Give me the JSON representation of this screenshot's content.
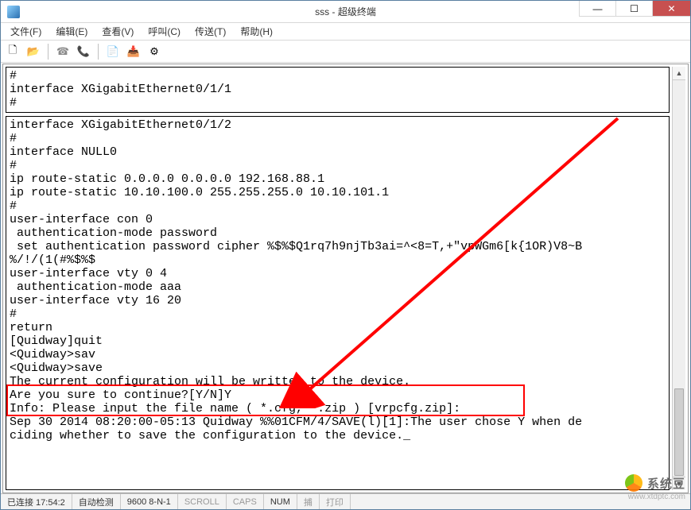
{
  "window": {
    "title": "sss - 超级终端"
  },
  "menu": {
    "items": [
      "文件(F)",
      "编辑(E)",
      "查看(V)",
      "呼叫(C)",
      "传送(T)",
      "帮助(H)"
    ]
  },
  "toolbar": {
    "icons": [
      {
        "name": "new-file-icon",
        "glyph": "🗋",
        "enabled": true
      },
      {
        "name": "open-file-icon",
        "glyph": "📂",
        "enabled": true
      },
      {
        "name": "sep"
      },
      {
        "name": "connect-icon",
        "glyph": "☎",
        "enabled": false
      },
      {
        "name": "disconnect-icon",
        "glyph": "📞",
        "enabled": true
      },
      {
        "name": "sep"
      },
      {
        "name": "send-icon",
        "glyph": "📄",
        "enabled": true
      },
      {
        "name": "receive-icon",
        "glyph": "📥",
        "enabled": true
      },
      {
        "name": "properties-icon",
        "glyph": "⚙",
        "enabled": true
      }
    ]
  },
  "terminal": {
    "upper": "#\ninterface XGigabitEthernet0/1/1\n#",
    "lower": "interface XGigabitEthernet0/1/2\n#\ninterface NULL0\n#\nip route-static 0.0.0.0 0.0.0.0 192.168.88.1\nip route-static 10.10.100.0 255.255.255.0 10.10.101.1\n#\nuser-interface con 0\n authentication-mode password\n set authentication password cipher %$%$Q1rq7h9njTb3ai=^<8=T,+\"vpWGm6[k{1OR)V8~B\n%/!/(1(#%$%$\nuser-interface vty 0 4\n authentication-mode aaa\nuser-interface vty 16 20\n#\nreturn\n[Quidway]quit\n<Quidway>sav\n<Quidway>save\nThe current configuration will be written to the device.\nAre you sure to continue?[Y/N]Y\nInfo: Please input the file name ( *.cfg, *.zip ) [vrpcfg.zip]:\nSep 30 2014 08:20:00-05:13 Quidway %%01CFM/4/SAVE(l)[1]:The user chose Y when de\nciding whether to save the configuration to the device._"
  },
  "highlight": {
    "line1": "The current configuration will be written to the device.",
    "line2": "Are you sure to continue?[Y/N]Y"
  },
  "statusbar": {
    "connection": "已连接 17:54:2",
    "detect": "自动检测",
    "port": "9600 8-N-1",
    "scroll": "SCROLL",
    "caps": "CAPS",
    "num": "NUM",
    "capture": "捕",
    "print": "打印"
  },
  "watermark": {
    "text": "系统豆",
    "url": "www.xtdptc.com"
  }
}
